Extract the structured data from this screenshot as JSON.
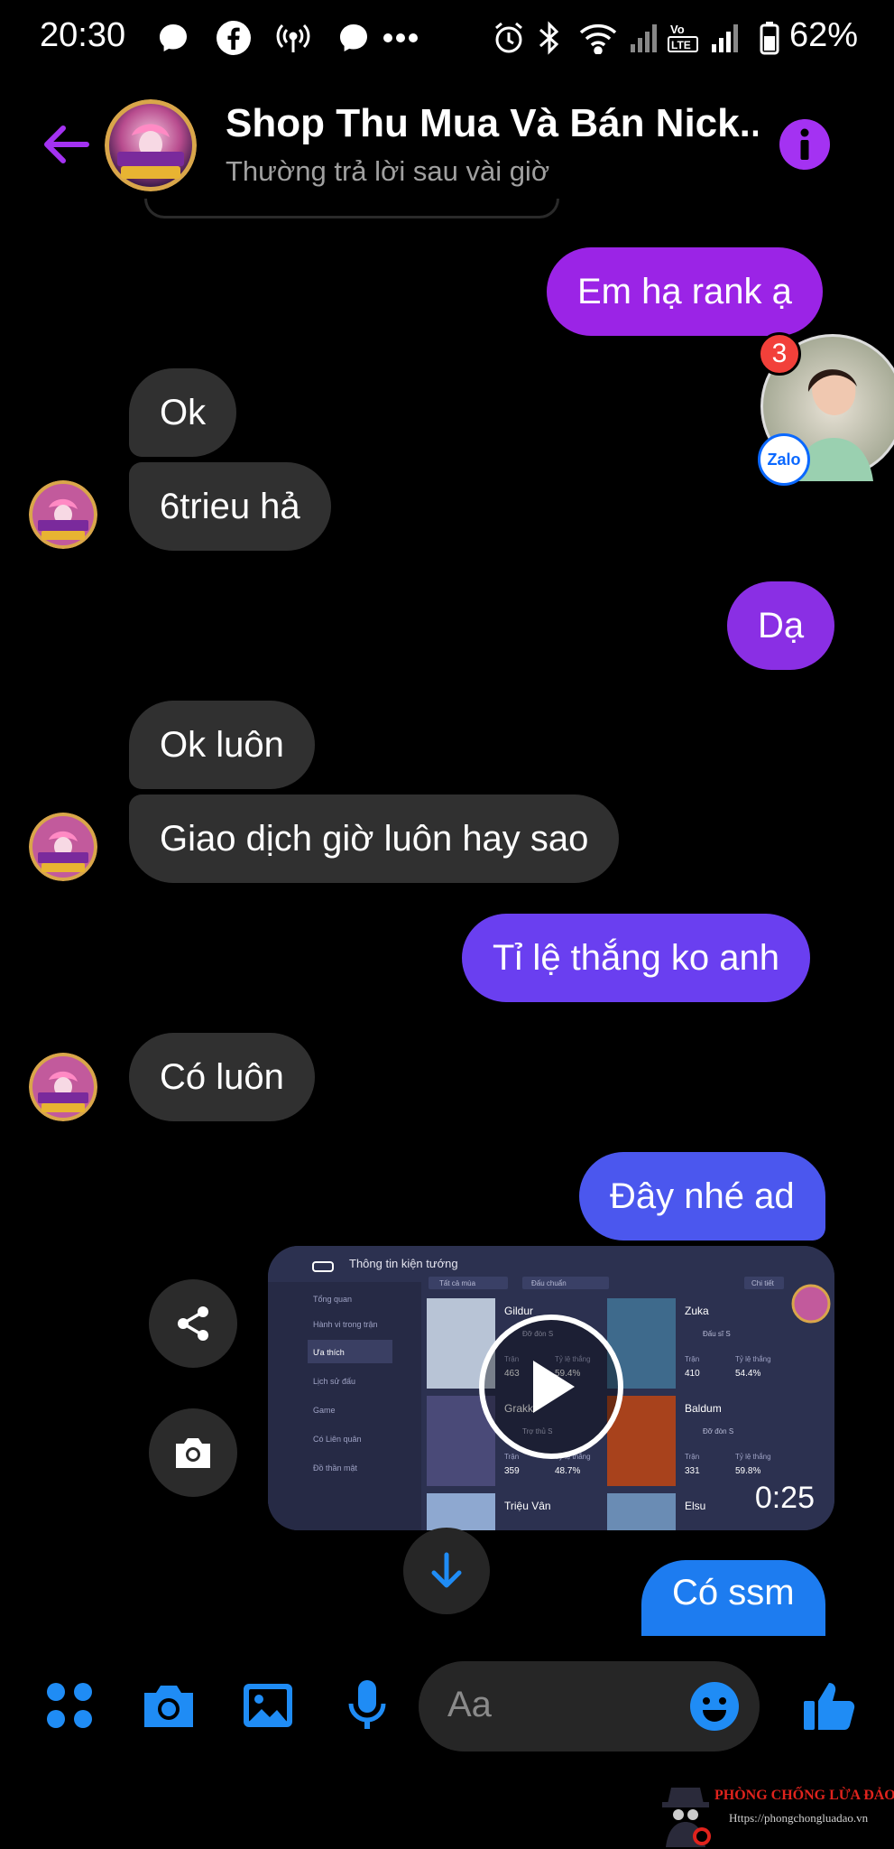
{
  "status_bar": {
    "time": "20:30",
    "icons": [
      "messenger-bubble-icon",
      "facebook-icon",
      "hotspot-icon",
      "messenger-bubble-icon",
      "more-dots-icon",
      "alarm-icon",
      "bluetooth-icon",
      "wifi-icon",
      "signal-icon",
      "volte-icon",
      "signal-icon",
      "battery-icon"
    ],
    "battery": "62%"
  },
  "header": {
    "title": "Shop Thu Mua Và Bán Nick...",
    "subtitle": "Thường trả lời sau vài giờ",
    "avatar_text": "CHĂM SÓC KHÁCH HÀNG"
  },
  "chat_head": {
    "badge": "3",
    "app": "Zalo"
  },
  "messages": [
    {
      "side": "out",
      "text": "Em hạ rank ạ",
      "color": "#9b24e6"
    },
    {
      "side": "in",
      "text": "Ok"
    },
    {
      "side": "in",
      "text": "6trieu hả"
    },
    {
      "side": "out",
      "text": "Dạ",
      "color": "#8a2fe4"
    },
    {
      "side": "in",
      "text": "Ok luôn"
    },
    {
      "side": "in",
      "text": "Giao dịch giờ luôn hay sao"
    },
    {
      "side": "out",
      "text": "Tỉ lệ thắng ko anh",
      "color": "#6a3ff0"
    },
    {
      "side": "in",
      "text": "Có luôn"
    },
    {
      "side": "out",
      "text": "Đây nhé ad",
      "color": "#4b57ee"
    },
    {
      "side": "out",
      "text": "Có ssm",
      "color": "#1d7cf0"
    }
  ],
  "video": {
    "title": "Thông tin kiện tướng",
    "filter1": "Tất cả mùa",
    "filter2": "Đấu chuẩn",
    "detail": "Chi tiết",
    "menu": [
      "Tổng quan",
      "Hành vi trong trận",
      "Ưa thích",
      "Lịch sử đấu",
      "Game",
      "Có Liên quân",
      "Đồ thần mật"
    ],
    "heroes": [
      {
        "name": "Gildur",
        "rank": "Đỡ đòn S",
        "matches": "463",
        "winrate": "59.4%"
      },
      {
        "name": "Zuka",
        "rank": "Đấu sĩ S",
        "matches": "410",
        "winrate": "54.4%"
      },
      {
        "name": "Grakk",
        "rank": "Trợ thủ S",
        "matches": "359",
        "winrate": "48.7%"
      },
      {
        "name": "Baldum",
        "rank": "Đỡ đòn S",
        "matches": "331",
        "winrate": "59.8%"
      },
      {
        "name": "Triệu Vân",
        "rank": "",
        "matches": "",
        "winrate": ""
      },
      {
        "name": "Elsu",
        "rank": "",
        "matches": "",
        "winrate": ""
      }
    ],
    "col_matches": "Trận",
    "col_winrate": "Tỷ lệ thắng",
    "duration": "0:25"
  },
  "composer": {
    "placeholder": "Aa"
  },
  "watermark": {
    "line1": "PHÒNG CHỐNG LỪA ĐẢO",
    "line2": "Https://phongchongluadao.vn"
  },
  "colors": {
    "accent": "#a432f2",
    "composer_icon": "#1f8cf5",
    "incoming_bubble": "#303030"
  }
}
